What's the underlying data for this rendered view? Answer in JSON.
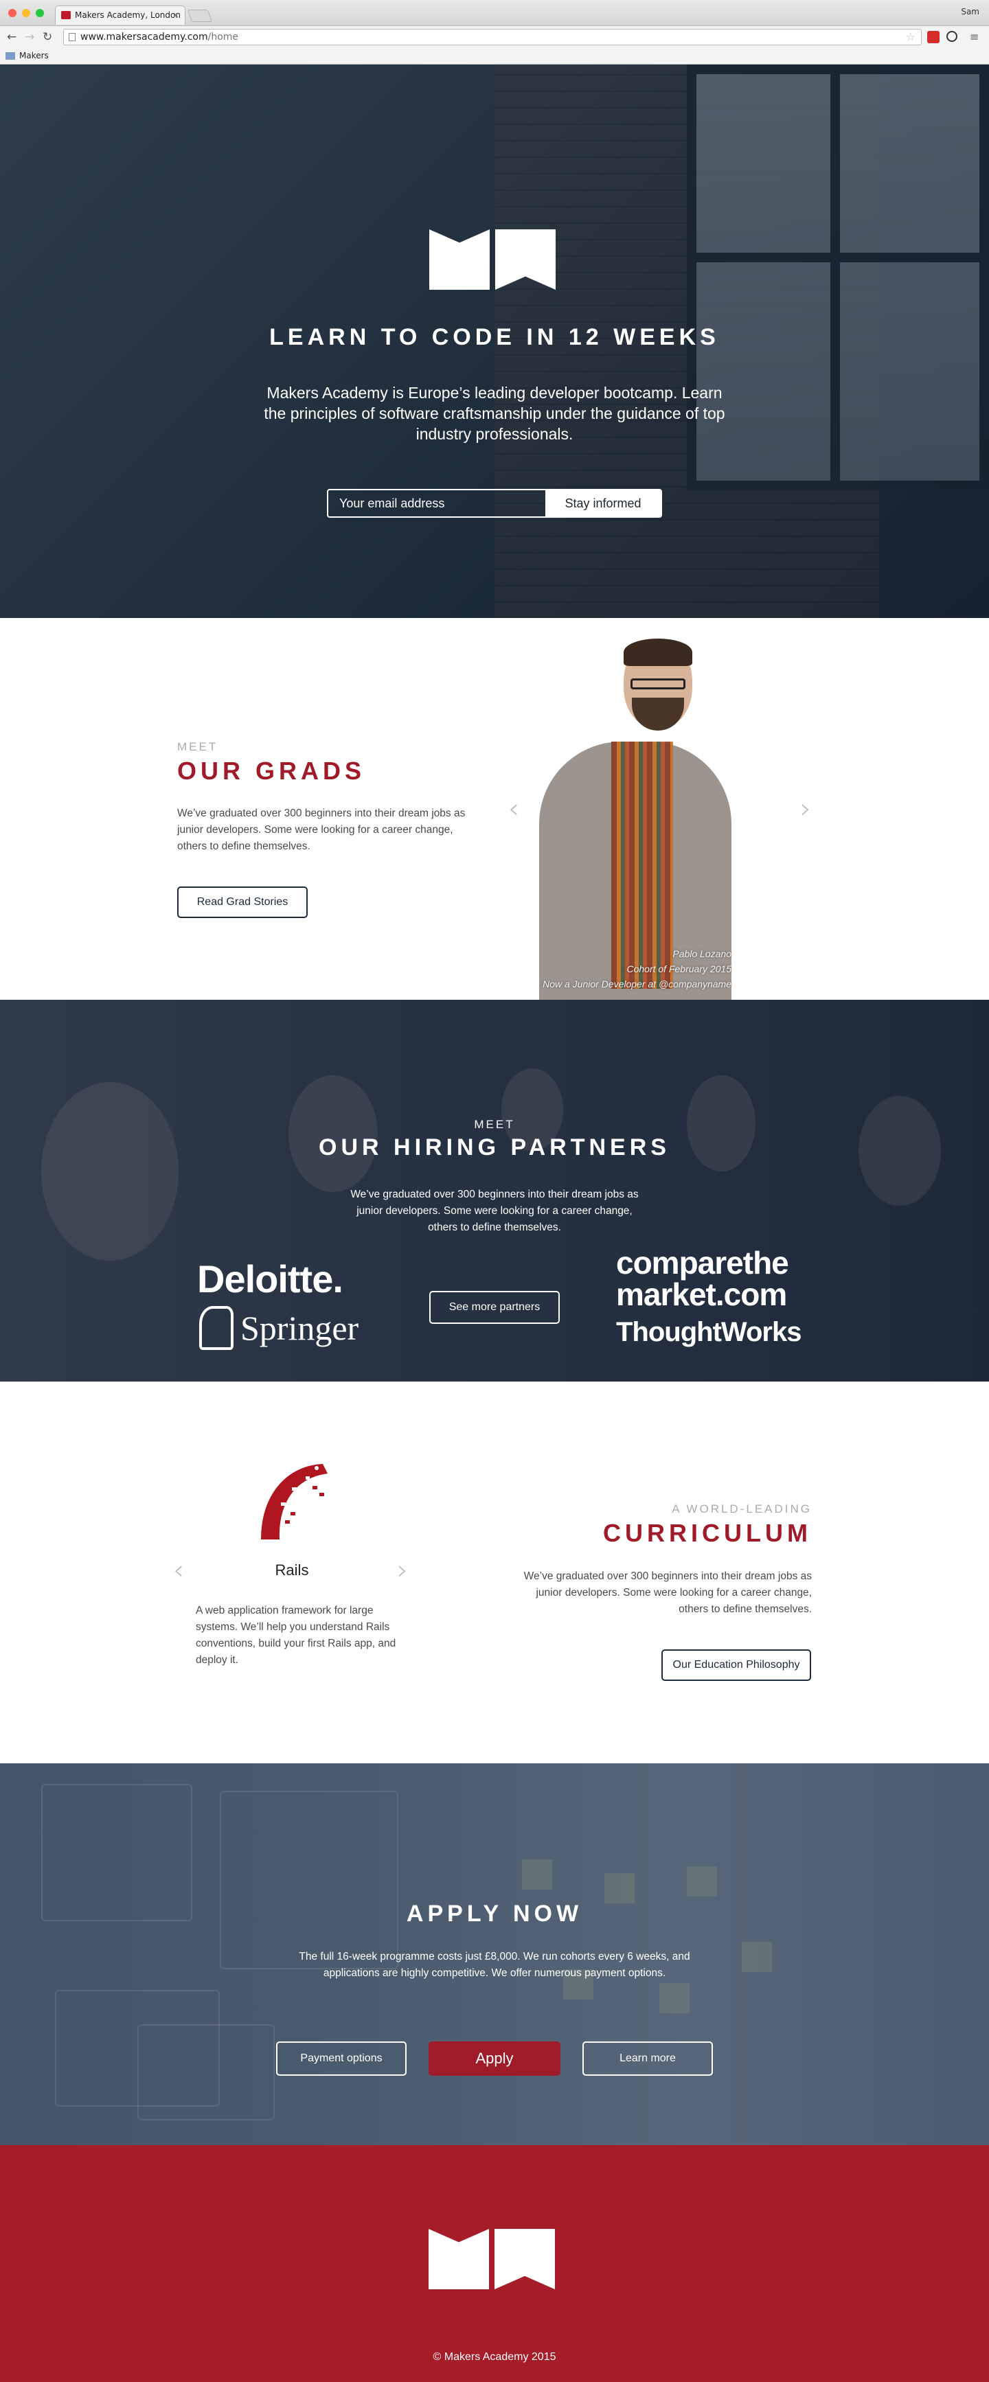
{
  "browser": {
    "tab_title": "Makers Academy, London",
    "url_domain": "www.makersacademy.com",
    "url_path": "/home",
    "user": "Sam",
    "bookmark": "Makers"
  },
  "hero": {
    "title": "LEARN TO CODE IN 12 WEEKS",
    "subtitle": "Makers Academy is Europe’s leading developer bootcamp. Learn the principles of software craftsmanship under the guidance of top industry professionals.",
    "email_placeholder": "Your email address",
    "cta": "Stay informed"
  },
  "grads": {
    "eyebrow": "MEET",
    "title": "OUR GRADS",
    "text": "We’ve graduated over 300 beginners into their dream jobs as junior developers. Some were looking for a career change, others to define themselves.",
    "button": "Read Grad Stories",
    "caption": [
      "Pablo Lozano",
      "Cohort of February 2015",
      "Now a Junior Developer at @companyname"
    ]
  },
  "partners": {
    "eyebrow": "MEET",
    "title": "OUR HIRING PARTNERS",
    "text": "We’ve graduated over 300 beginners into their dream jobs as junior developers. Some were looking for a career change, others to define themselves.",
    "button": "See more partners",
    "logos": {
      "deloitte": "Deloitte.",
      "springer": "Springer",
      "compare_line1": "comparethe",
      "compare_line2": "market.com",
      "thoughtworks": "ThoughtWorks"
    }
  },
  "curriculum": {
    "eyebrow": "A WORLD-LEADING",
    "title": "CURRICULUM",
    "text": "We’ve graduated over 300 beginners into their dream jobs as junior developers. Some were looking for a career change, others to define themselves.",
    "button": "Our Education Philosophy",
    "slide_name": "Rails",
    "slide_text": "A web application framework for large systems. We’ll help you understand Rails conventions, build your first Rails app, and deploy it."
  },
  "apply": {
    "title": "APPLY NOW",
    "text": "The full 16-week programme costs just £8,000. We run cohorts every 6 weeks, and applications are highly competitive. We offer numerous payment options.",
    "buttons": [
      "Payment options",
      "Apply",
      "Learn more"
    ]
  },
  "footer": {
    "copyright": "© Makers Academy 2015"
  },
  "colors": {
    "brand_red": "#a61c28",
    "navy": "#1d2a3a"
  }
}
